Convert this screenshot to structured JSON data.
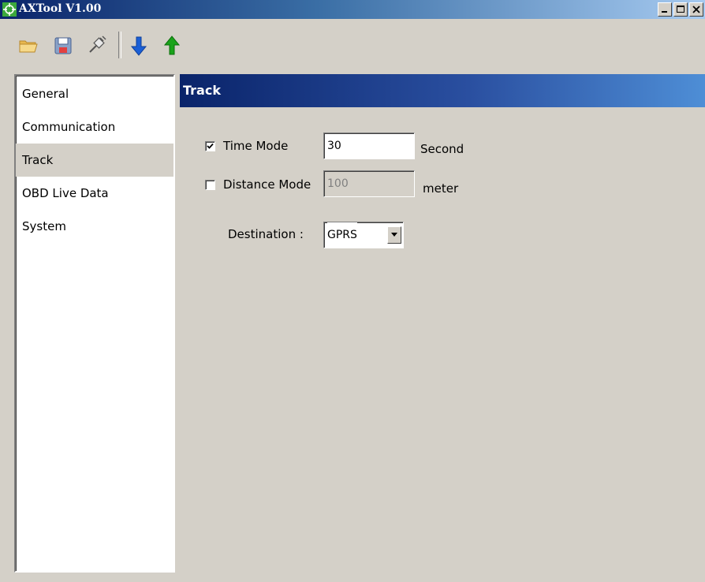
{
  "window": {
    "title": "AXTool V1.00",
    "icon": "crosshair-app-icon",
    "controls": [
      "minimize-icon",
      "maximize-icon",
      "close-icon"
    ]
  },
  "toolbar": {
    "buttons": [
      {
        "icon": "open-folder-icon"
      },
      {
        "icon": "save-disk-icon"
      },
      {
        "icon": "connect-plug-icon"
      },
      {
        "icon": "download-arrow-icon",
        "color": "#1a5fd6"
      },
      {
        "icon": "upload-arrow-icon",
        "color": "#1aa31a"
      }
    ]
  },
  "sidebar": {
    "selected": "Track",
    "items": [
      {
        "label": "General"
      },
      {
        "label": "Communication"
      },
      {
        "label": "Track"
      },
      {
        "label": "OBD Live Data"
      },
      {
        "label": "System"
      }
    ]
  },
  "panel": {
    "title": "Track",
    "time_mode": {
      "label": "Time Mode",
      "checked": true,
      "value": "30",
      "unit": "Second"
    },
    "distance_mode": {
      "label": "Distance Mode",
      "checked": false,
      "value": "100",
      "unit": "meter",
      "enabled": false
    },
    "destination": {
      "label": "Destination :",
      "value": "GPRS"
    }
  },
  "colors": {
    "titlebar_start": "#0a246a",
    "titlebar_end": "#a6caf0",
    "panel_header_start": "#0a246a",
    "panel_header_end": "#4e8ed6",
    "background": "#d4d0c8"
  }
}
